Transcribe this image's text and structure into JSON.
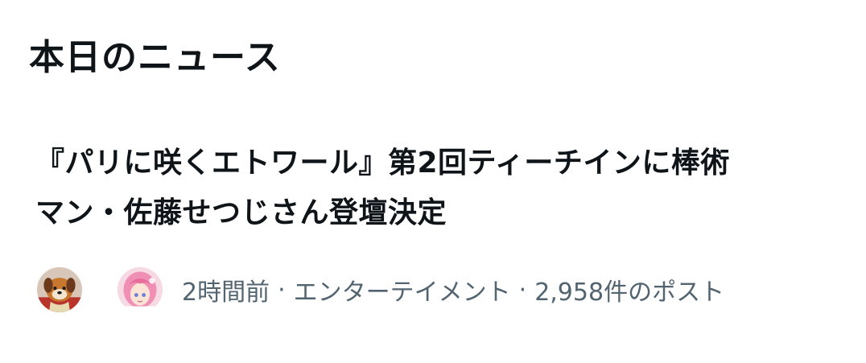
{
  "trending": {
    "section_title": "本日のニュース",
    "story": {
      "headline_line1": "『パリに咲くエトワール』第2回ティーチインに棒術",
      "headline_line2": "マン・佐藤せつじさん登壇決定",
      "time_ago": "2時間前",
      "category": "エンターテイメント",
      "post_count": "2,958件のポスト",
      "separator": "·",
      "avatars": [
        {
          "icon": "dog-character-avatar"
        },
        {
          "icon": "pink-hair-character-avatar"
        }
      ]
    }
  },
  "colors": {
    "text_primary": "#0f1419",
    "text_secondary": "#536471",
    "background": "#ffffff"
  }
}
